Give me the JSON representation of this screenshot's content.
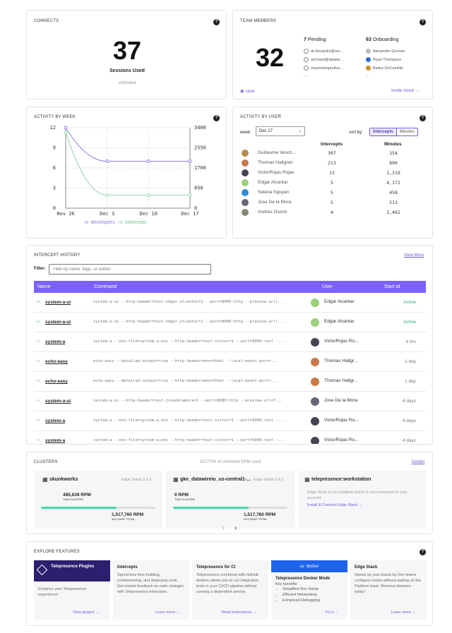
{
  "connects": {
    "title": "CONNECTS",
    "count": "37",
    "label": "Sessions Used",
    "limit": "Unlimited"
  },
  "team": {
    "title": "TEAM MEMBERS",
    "count": "32",
    "pending_count": "7",
    "pending_label": "Pending",
    "onboarding_count": "63",
    "onboarding_label": "Onboarding",
    "pending": [
      "dr.theopolis@me...",
      "arichard@datawi...",
      "maximelegaultve..."
    ],
    "onboarding": [
      "Alexandre Gervais",
      "Ryan Thompson",
      "Bailey DeCamillis"
    ],
    "ellipsis": "...",
    "view": "view",
    "invite": "Invite more →"
  },
  "activity_week": {
    "title": "ACTIVITY BY WEEK",
    "legend_dev": "developers",
    "legend_int": "intercepts"
  },
  "chart_data": {
    "type": "line",
    "categories": [
      "Nov 26",
      "Dec 3",
      "Dec 10",
      "Dec 17"
    ],
    "series": [
      {
        "name": "developers",
        "axis": "left",
        "values": [
          12,
          7,
          7,
          7
        ],
        "color": "#8b7fe0"
      },
      {
        "name": "intercepts",
        "axis": "right",
        "values": [
          3200,
          550,
          550,
          550
        ],
        "color": "#8fd6a9"
      }
    ],
    "ylim_left": [
      0,
      12
    ],
    "yticks_left": [
      0,
      3,
      6,
      9,
      12
    ],
    "ylim_right": [
      0,
      3400
    ],
    "yticks_right": [
      0,
      850,
      1700,
      2550,
      3400
    ],
    "grid": true,
    "legend": "bottom"
  },
  "activity_user": {
    "title": "ACTIVITY BY USER",
    "week_label": "week:",
    "week_value": "Dec 17",
    "sort_label": "sort by:",
    "sort_a": "Intercepts",
    "sort_b": "Minutes",
    "col_int": "Intercepts",
    "col_min": "Minutes",
    "rows": [
      {
        "name": "Guillaume Vesch...",
        "i": "307",
        "m": "154",
        "c": "#b38a4a"
      },
      {
        "name": "Thomas Hallgren",
        "i": "213",
        "m": "890",
        "c": "#c97a4a"
      },
      {
        "name": "VictorRojas Rojas",
        "i": "13",
        "m": "1,319",
        "c": "#445"
      },
      {
        "name": "Edgar Alcantar",
        "i": "5",
        "m": "4,172",
        "c": "#9ad07a"
      },
      {
        "name": "Selena Nguyen",
        "i": "5",
        "m": "458",
        "c": "#2a8fd6"
      },
      {
        "name": "Jose De la Mora",
        "i": "5",
        "m": "213",
        "c": "#667"
      },
      {
        "name": "Andres Osorio",
        "i": "4",
        "m": "1,481",
        "c": "#887"
      }
    ]
  },
  "history": {
    "title": "INTERCEPT HISTORY",
    "view_more": "View More",
    "filter_label": "Filter:",
    "filter_placeholder": "Filter by name, flags, or author",
    "cols": {
      "name": "Name",
      "command": "Command",
      "user": "User",
      "start": "Start at"
    },
    "rows": [
      {
        "name": "system-a-ui",
        "cmd": "system-a-ui --http-header=test-edgar.alcantar=1 --port=8080:http --preview-url|...",
        "user": "Edgar Alcantar",
        "start": "Active",
        "active": true,
        "c": "#9ad07a"
      },
      {
        "name": "system-a-ui",
        "cmd": "system-a-ui --http-header=test-edgar.alcantar=1 --port=8080:http --preview-url|...",
        "user": "Edgar Alcantar",
        "start": "Active",
        "active": true,
        "c": "#9ad07a"
      },
      {
        "name": "system-a",
        "cmd": "system-a --env-file=system-a.env --http-header=test-victor=1 --port=9090:rest -...",
        "user": "VictorRojas Ro...",
        "start": "4 hrs",
        "active": false,
        "c": "#445"
      },
      {
        "name": "echo-easy",
        "cmd": "echo-easy --detailed-output=true --http-header=who=thhal --local-mount-port=...",
        "user": "Thomas Hallgr...",
        "start": "1 day",
        "active": false,
        "c": "#c97a4a"
      },
      {
        "name": "echo-easy",
        "cmd": "echo-easy --detailed-output=true --http-header=who=thhal --local-mount-port=...",
        "user": "Thomas Hallgr...",
        "start": "1 day",
        "active": false,
        "c": "#c97a4a"
      },
      {
        "name": "system-a-ui",
        "cmd": "system-a-ui --http-header=test-josedelamora=1 --port=8080:http --preview-url=f...",
        "user": "Jose De la Mora",
        "start": "4 days",
        "active": false,
        "c": "#667"
      },
      {
        "name": "system-a",
        "cmd": "system-a --env-file=system-a.env --http-header=test-victor=1 --port=9090:rest -...",
        "user": "VictorRojas Ro...",
        "start": "4 days",
        "active": false,
        "c": "#445"
      },
      {
        "name": "system-a",
        "cmd": "system-a --env-file=system-a.env --http-header=test-victor=1 --port=9090:rest -...",
        "user": "VictorRojas Ro...",
        "start": "4 days",
        "active": false,
        "c": "#445"
      }
    ]
  },
  "clusters": {
    "title": "CLUSTERS",
    "rpm_used": "1517760 of Unlimited RPM used",
    "details": "Details",
    "c1": {
      "name": "skunkworks",
      "version": "Edge Stack-3.9.3",
      "rpm": "485,639 RPM",
      "this": "THIS CLUSTER",
      "total": "1,517,760 RPM",
      "acct": "ACCOUNT TOTAL",
      "fraction": 0.32
    },
    "c2": {
      "name": "gke_datawireio_us-central1-...",
      "version": "Edge Stack-3.9.3",
      "rpm": "0 RPM",
      "this": "THIS CLUSTER",
      "total": "1,517,760 RPM",
      "acct": "ACCOUNT TOTAL",
      "fraction": 0.0
    },
    "c3": {
      "name": "telepresence:workstation",
      "msg": "Edge Stack is not installed and/or is not connected to your account.",
      "link": "Install & Connect Edge Stack →"
    },
    "prev": "‹",
    "next": "›"
  },
  "explore": {
    "title": "EXPLORE FEATURES",
    "f1": {
      "banner": "Telepresence Plugins",
      "text": "Enhance your Telepresence experience!",
      "link": "View plugins →"
    },
    "f2": {
      "title": "Intercepts",
      "text": "Spend less time building, containerizing, and deploying code. Get instant feedback on code changes with Telepresence Intercepts.",
      "link": "Learn more →"
    },
    "f3": {
      "title": "Telepresence for CI",
      "text": "Telepresence combined with GitHub Actions allows you to run integration tests in your CI/CD pipeline without running a dependent service.",
      "link": "Read instructions →"
    },
    "f4": {
      "banner": "docker",
      "title": "Telepresence Docker Mode",
      "sub": "Key benefits:",
      "items": [
        "Simplified Dev Setup",
        "Efficient Networking",
        "Enhanced Debugging"
      ],
      "link": "Try it →"
    },
    "f5": {
      "title": "Edge Stack",
      "text": "Speed up your teams by Dev teams configure routes without waiting on the Platform team. Remove blockers today!",
      "link": "Learn more →"
    }
  }
}
